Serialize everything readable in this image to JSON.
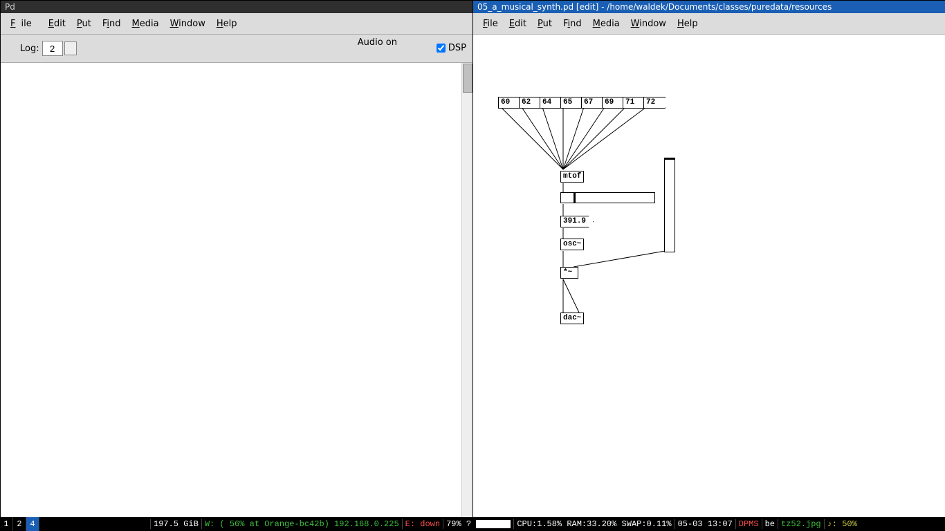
{
  "left_window": {
    "title": "Pd",
    "menu": {
      "file": "File",
      "edit": "Edit",
      "put": "Put",
      "find": "Find",
      "media": "Media",
      "window": "Window",
      "help": "Help"
    },
    "log_label": "Log:",
    "log_value": "2",
    "audio_label": "Audio on",
    "dsp_label": "DSP",
    "dsp_checked": true
  },
  "right_window": {
    "title": "05_a_musical_synth.pd  [edit]  -  /home/waldek/Documents/classes/puredata/resources",
    "menu": {
      "file": "File",
      "edit": "Edit",
      "put": "Put",
      "find": "Find",
      "media": "Media",
      "window": "Window",
      "help": "Help"
    },
    "msg_notes": [
      "60",
      "62",
      "64",
      "65",
      "67",
      "69",
      "71",
      "72"
    ],
    "obj_mtof": "mtof",
    "num_freq": "391.9",
    "obj_osc": "osc~",
    "obj_mult": "*~",
    "obj_dac": "dac~"
  },
  "statusbar": {
    "workspaces": [
      "1",
      "2",
      "4"
    ],
    "active_ws": "4",
    "disk": "197.5 GiB",
    "wifi": "W: (  56% at Orange-bc42b)  192.168.0.225",
    "eth": "E:  down",
    "batt": "79%  ?",
    "cpu": "CPU:1.58%  RAM:33.20%  SWAP:0.11%",
    "date": "05-03 13:07",
    "dpms": "DPMS",
    "kb": "be",
    "img": "tz52.jpg",
    "vol": "♪:  50%"
  }
}
